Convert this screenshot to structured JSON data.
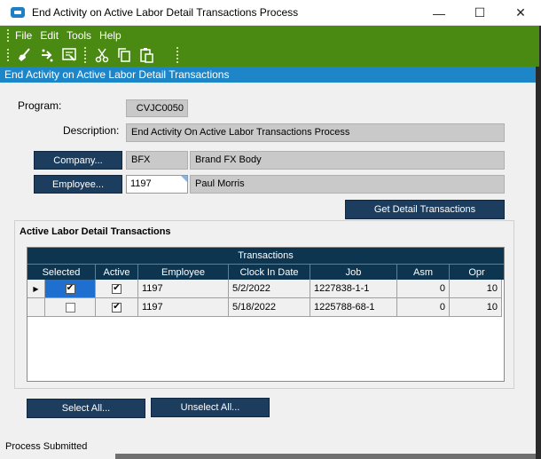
{
  "window": {
    "title": "End Activity on Active Labor Detail Transactions Process",
    "minimize": "—",
    "maximize": "☐",
    "close": "✕"
  },
  "menu": [
    "File",
    "Edit",
    "Tools",
    "Help"
  ],
  "form_title": "End Activity on Active Labor Detail Transactions",
  "program": {
    "label": "Program:",
    "value": "CVJC0050"
  },
  "description": {
    "label": "Description:",
    "value": "End Activity On Active Labor Transactions Process"
  },
  "company": {
    "button": "Company...",
    "code": "BFX",
    "name": "Brand FX Body"
  },
  "employee": {
    "button": "Employee...",
    "code": "1197",
    "name": "Paul Morris"
  },
  "get_detail_button": "Get Detail Transactions",
  "group_title": "Active Labor Detail Transactions",
  "grid": {
    "band": "Transactions",
    "columns": [
      "Selected",
      "Active",
      "Employee",
      "Clock In Date",
      "Job",
      "Asm",
      "Opr"
    ],
    "rows": [
      {
        "indicator": "▶",
        "selected": true,
        "active": true,
        "employee": "1197",
        "clock_in": "5/2/2022",
        "job": "1227838-1-1",
        "asm": "0",
        "opr": "10"
      },
      {
        "indicator": "",
        "selected": false,
        "active": true,
        "employee": "1197",
        "clock_in": "5/18/2022",
        "job": "1225788-68-1",
        "asm": "0",
        "opr": "10"
      }
    ]
  },
  "select_all_button": "Select All...",
  "unselect_all_button": "Unselect All...",
  "status_text": "Process Submitted",
  "colors": {
    "accent_green": "#4a8a12",
    "form_title_blue": "#1c86c9",
    "navy": "#1d3d5f"
  }
}
